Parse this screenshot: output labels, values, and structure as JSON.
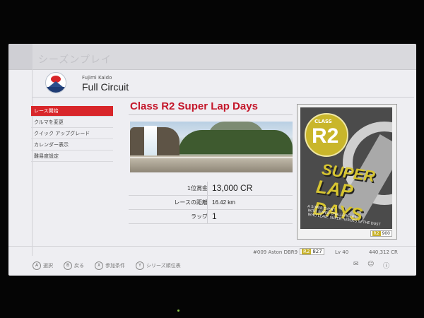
{
  "screen": {
    "mode_title": "シーズンプレイ"
  },
  "track": {
    "subtitle": "Fujimi Kaido",
    "name": "Full Circuit",
    "logo_icon": "fujimi-kaido-logo-icon"
  },
  "menu": {
    "items": [
      {
        "label": "レース開始",
        "active": true
      },
      {
        "label": "クルマを変更",
        "active": false
      },
      {
        "label": "クイック アップグレード",
        "active": false
      },
      {
        "label": "カレンダー表示",
        "active": false
      },
      {
        "label": "難易度設定",
        "active": false
      }
    ]
  },
  "event": {
    "title": "Class R2 Super Lap Days"
  },
  "details": {
    "rows": [
      {
        "label": "1位賞金",
        "value": "13,000 CR"
      },
      {
        "label": "レースの距離",
        "value": "16.42 km"
      },
      {
        "label": "ラップ",
        "value": "1"
      }
    ]
  },
  "poster": {
    "class_label": "CLASS",
    "class_code": "R2",
    "slogan_line1": "SUPER",
    "slogan_line2": "LAP DAYS",
    "tagline1": "A SUPER EVENT",
    "tagline2": "WITH SUPER CHALLENGERS,",
    "tagline3": "WHO LEAVE SUPER HEROES IN THE DUST",
    "badge_class": "R2",
    "badge_value": "900"
  },
  "status": {
    "car": "#009 Aston DBR9",
    "pp_class": "R2",
    "pp_value": "827",
    "level": "Lv 40",
    "credits": "440,312 CR"
  },
  "buttons": [
    {
      "key": "A",
      "label": "選択"
    },
    {
      "key": "B",
      "label": "戻る"
    },
    {
      "key": "X",
      "label": "参加条件"
    },
    {
      "key": "Y",
      "label": "シリーズ順位表"
    }
  ],
  "colors": {
    "accent_red": "#d8262a",
    "title_red": "#c4162a",
    "class_gold": "#c9b62b"
  }
}
